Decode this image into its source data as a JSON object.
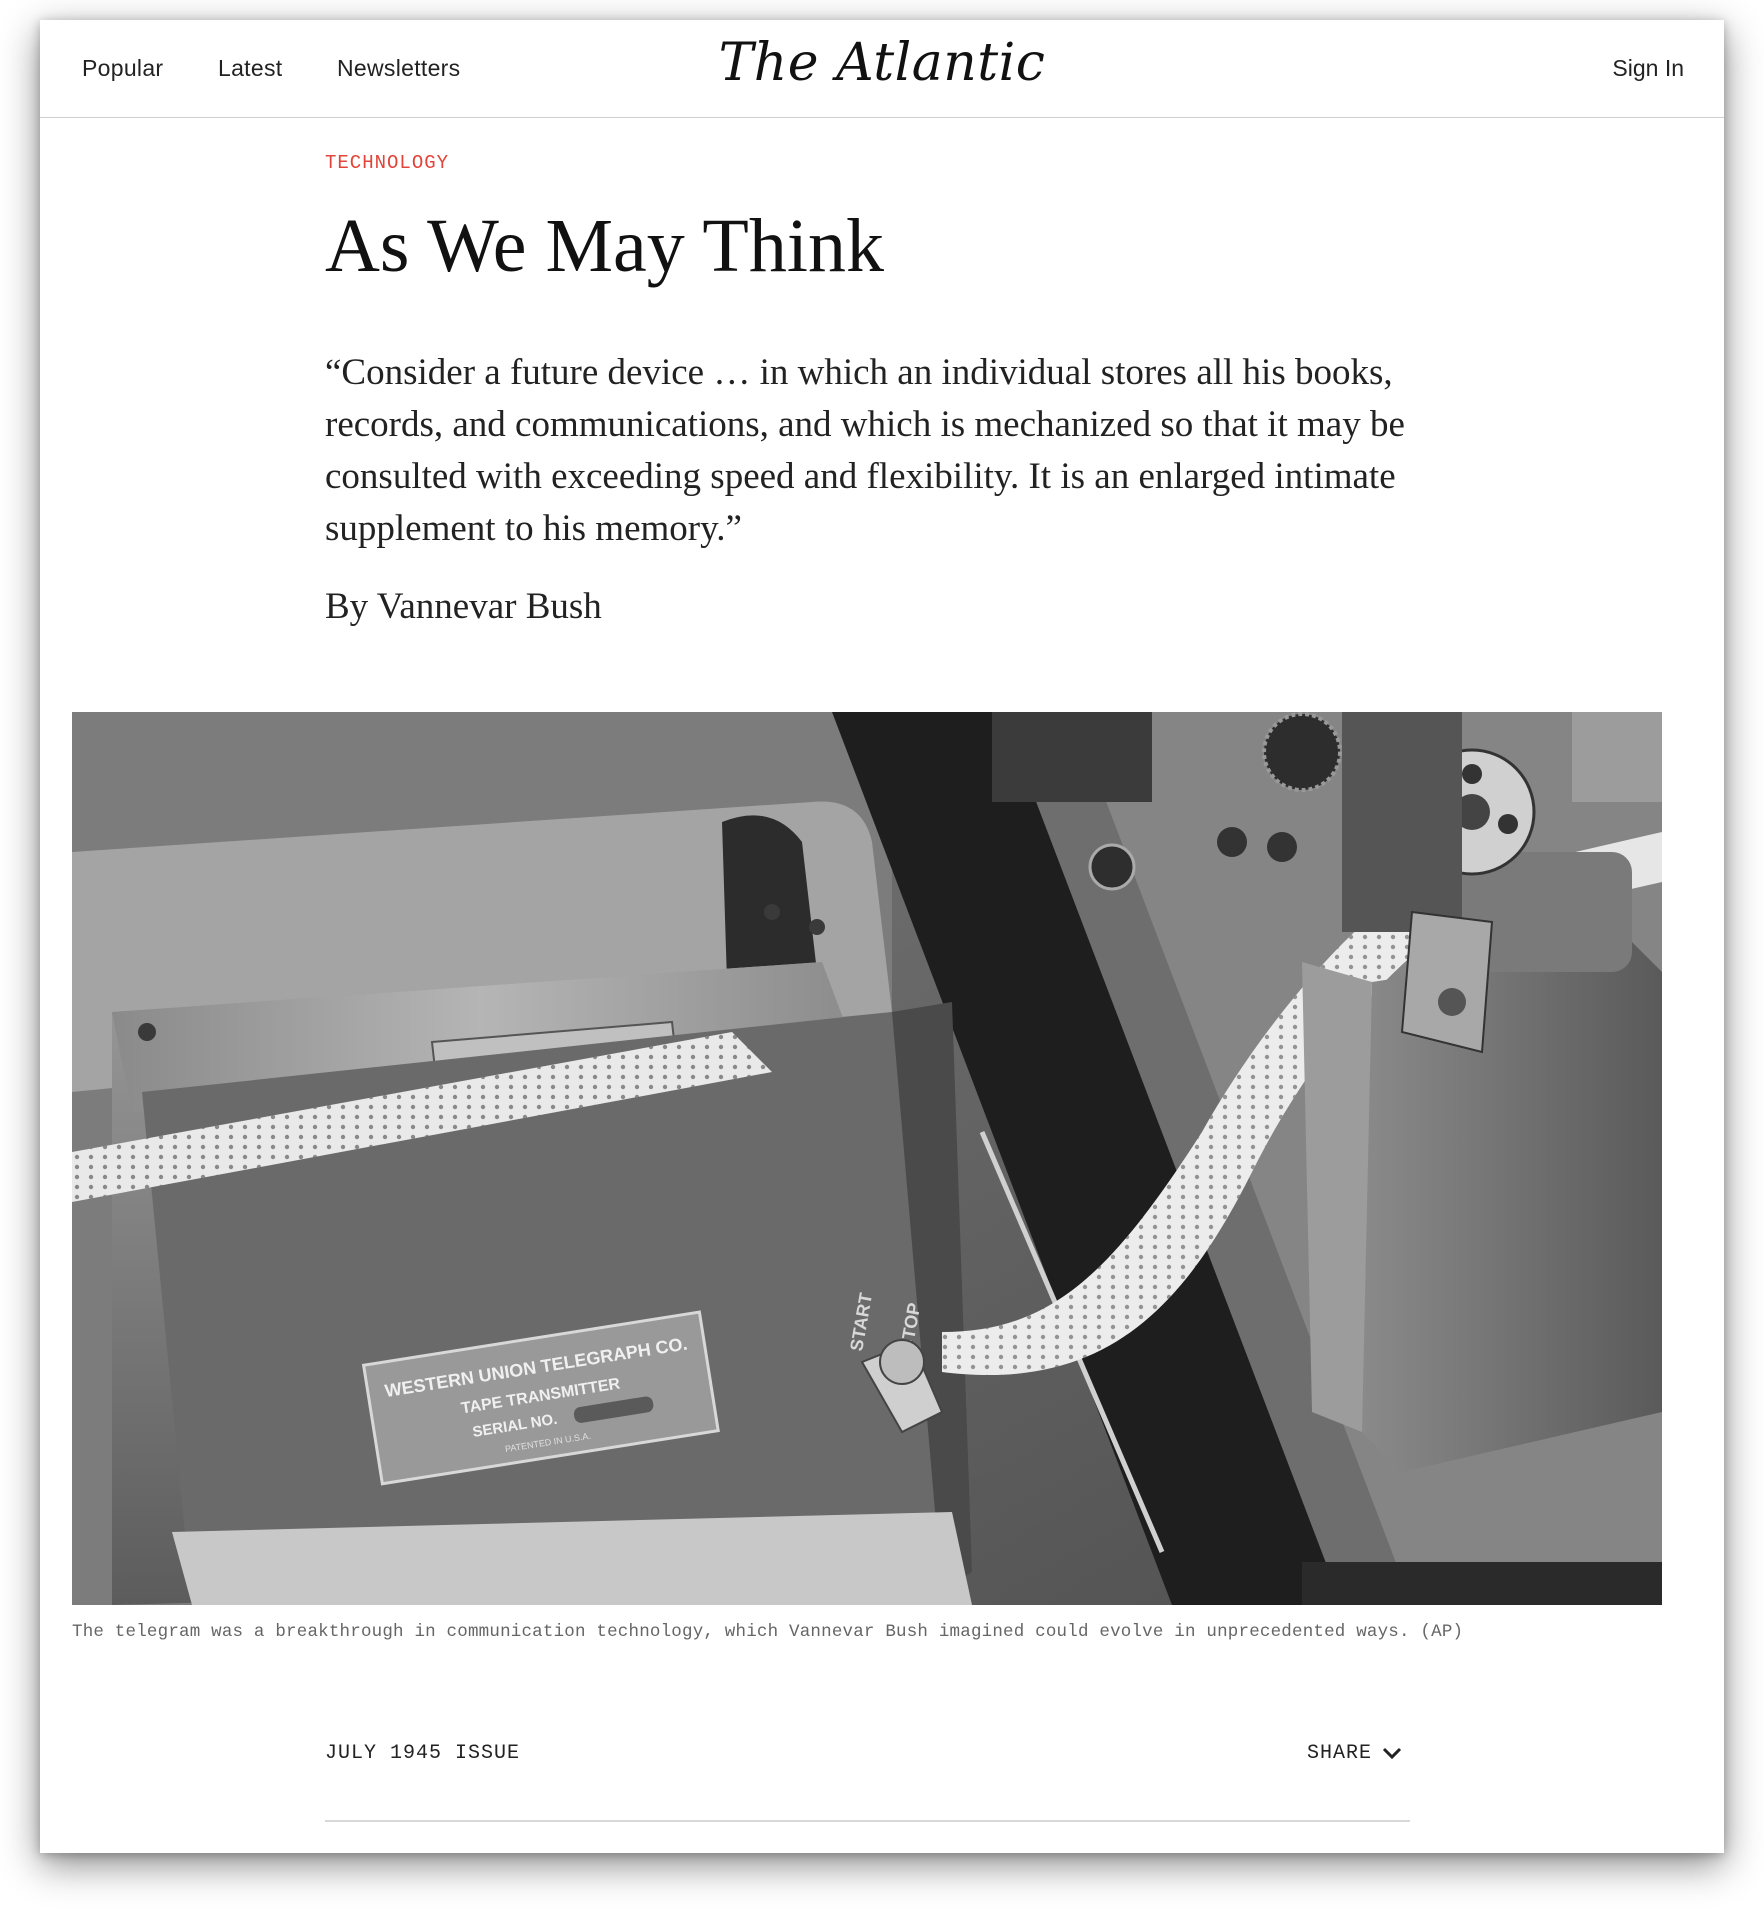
{
  "header": {
    "nav": [
      "Popular",
      "Latest",
      "Newsletters"
    ],
    "logo": "The Atlantic",
    "sign_in": "Sign In"
  },
  "article": {
    "section": "TECHNOLOGY",
    "title": "As We May Think",
    "dek": "“Consider a future device …  in which an individual stores all his books, records, and communications, and which is mechanized so that it may be consulted with exceeding speed and flexibility. It is an enlarged intimate supplement to his memory.”",
    "byline_prefix": "By ",
    "author": "Vannevar Bush"
  },
  "photo": {
    "plate_lines": [
      "WESTERN UNION TELEGRAPH CO.",
      "TAPE TRANSMITTER",
      "SERIAL NO.",
      "PATENTED IN U.S.A."
    ],
    "switch_labels": [
      "START",
      "STOP"
    ],
    "caption": "The telegram was a breakthrough in communication technology, which Vannevar Bush imagined could evolve in unprecedented ways. (AP)"
  },
  "footer_bar": {
    "issue": "JULY 1945 ISSUE",
    "share": "SHARE",
    "share_icon": "chevron-down-icon"
  }
}
